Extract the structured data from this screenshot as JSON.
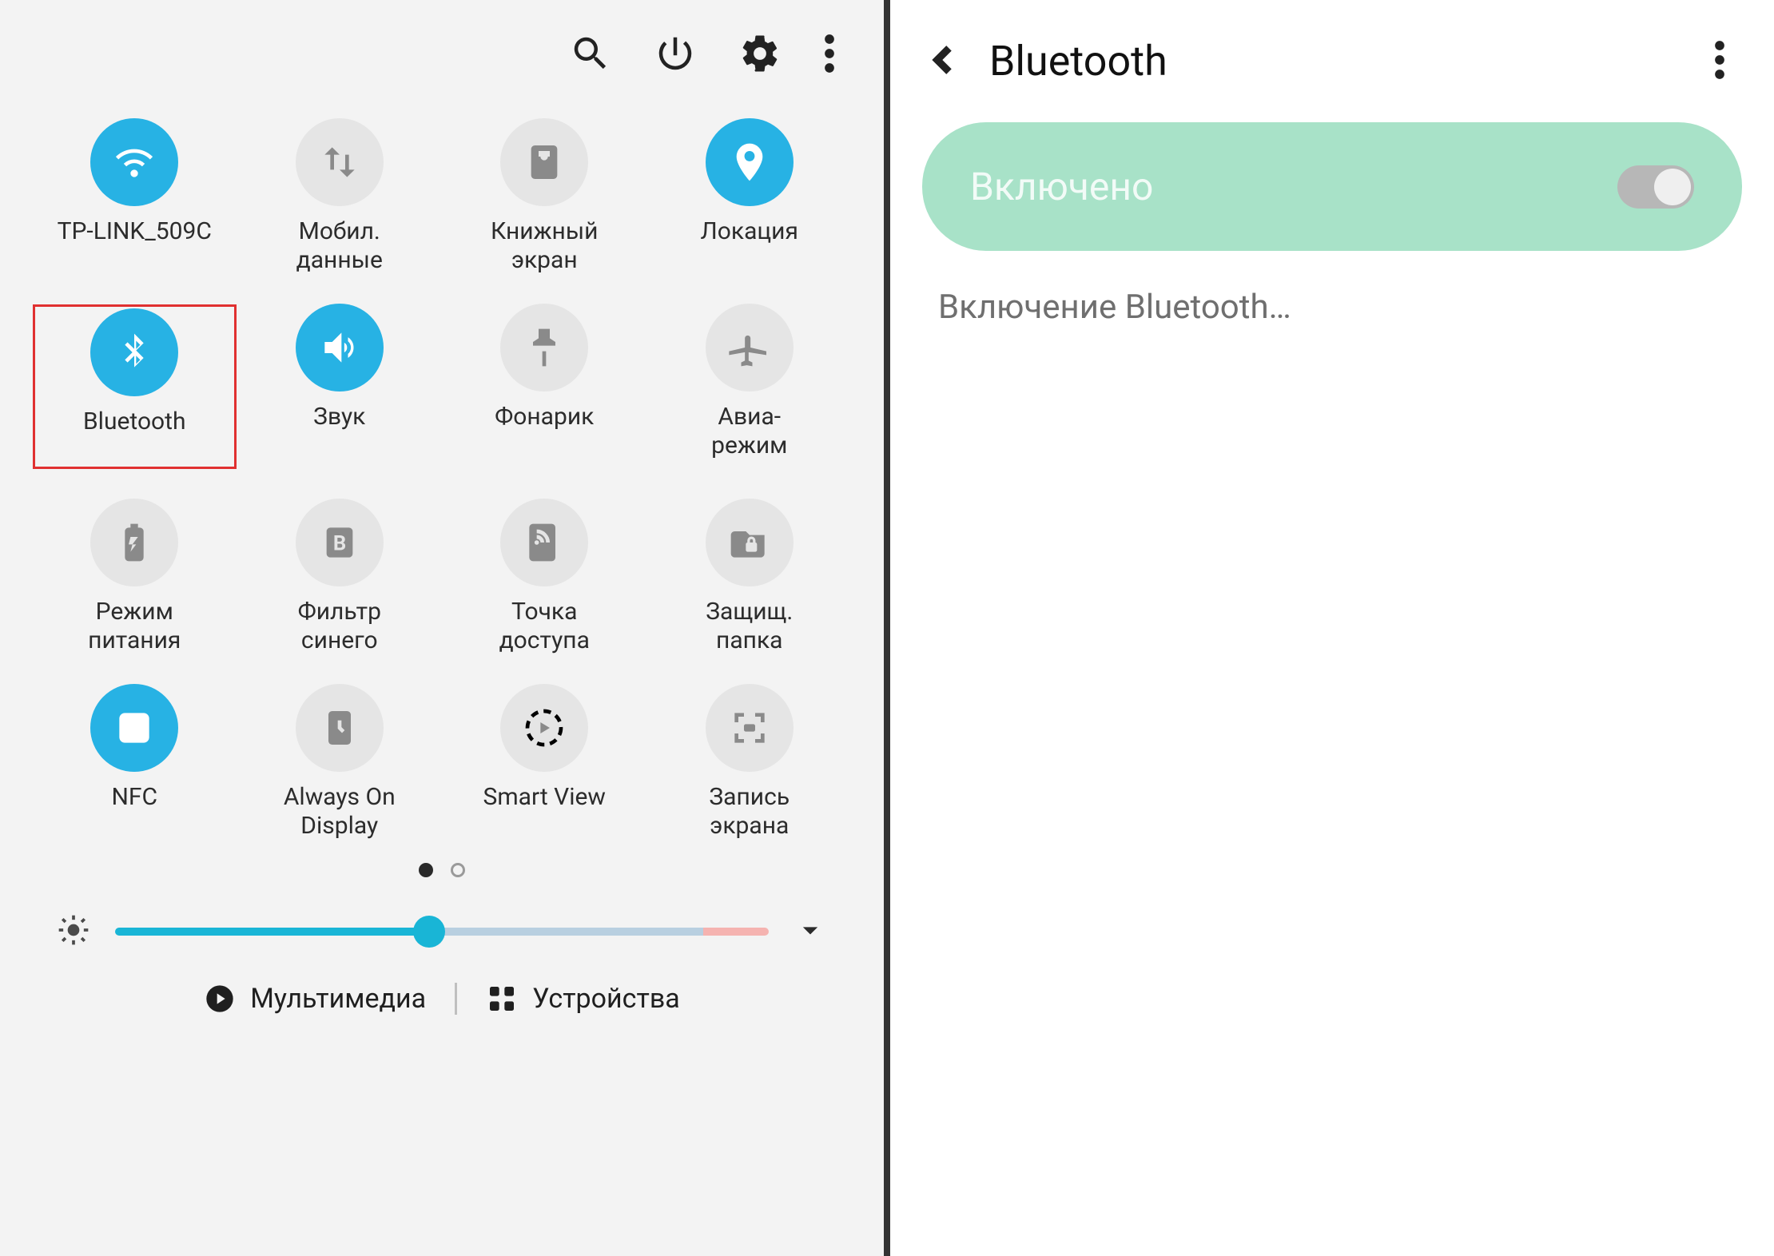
{
  "left": {
    "tiles": [
      {
        "id": "wifi",
        "label": "TP-LINK_509C",
        "active": true,
        "icon": "wifi"
      },
      {
        "id": "data",
        "label": "Мобил.\nданные",
        "active": false,
        "icon": "data"
      },
      {
        "id": "book",
        "label": "Книжный\nэкран",
        "active": false,
        "icon": "book"
      },
      {
        "id": "location",
        "label": "Локация",
        "active": true,
        "icon": "pin"
      },
      {
        "id": "bluetooth",
        "label": "Bluetooth",
        "active": true,
        "icon": "bt",
        "highlight": true
      },
      {
        "id": "sound",
        "label": "Звук",
        "active": true,
        "icon": "sound"
      },
      {
        "id": "flash",
        "label": "Фонарик",
        "active": false,
        "icon": "flash"
      },
      {
        "id": "airplane",
        "label": "Авиа-\nрежим",
        "active": false,
        "icon": "plane"
      },
      {
        "id": "power",
        "label": "Режим\nпитания",
        "active": false,
        "icon": "battery"
      },
      {
        "id": "bluefilter",
        "label": "Фильтр\nсинего",
        "active": false,
        "icon": "bfilter"
      },
      {
        "id": "hotspot",
        "label": "Точка\nдоступа",
        "active": false,
        "icon": "hotspot"
      },
      {
        "id": "secure",
        "label": "Защищ.\nпапка",
        "active": false,
        "icon": "lockfolder"
      },
      {
        "id": "nfc",
        "label": "NFC",
        "active": true,
        "icon": "nfc"
      },
      {
        "id": "aod",
        "label": "Always On\nDisplay",
        "active": false,
        "icon": "aod"
      },
      {
        "id": "smartview",
        "label": "Smart View",
        "active": false,
        "icon": "cast"
      },
      {
        "id": "screenrec",
        "label": "Запись\nэкрана",
        "active": false,
        "icon": "rec"
      }
    ],
    "pager_total": 2,
    "pager_active": 0,
    "brightness_percent": 48,
    "footer": {
      "multimedia": "Мультимедиа",
      "devices": "Устройства"
    }
  },
  "right": {
    "title": "Bluetooth",
    "pill_label": "Включено",
    "toggle_on": true,
    "status": "Включение Bluetooth…"
  }
}
